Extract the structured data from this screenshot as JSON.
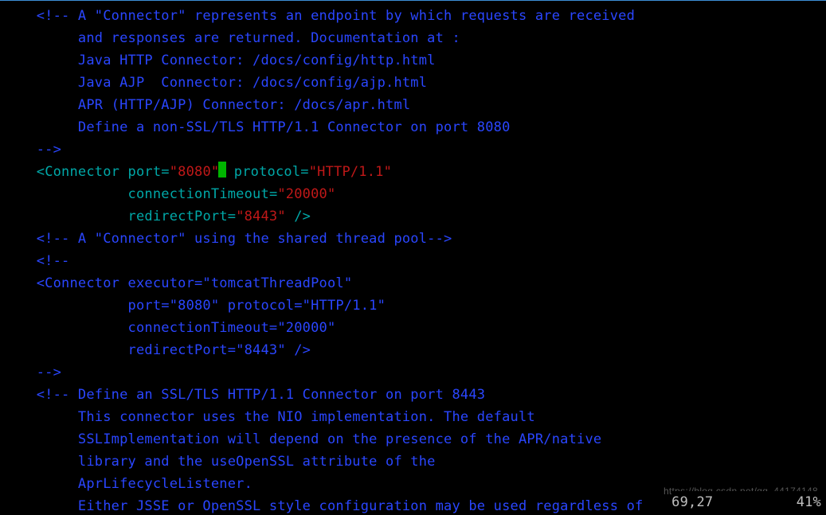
{
  "code": {
    "c1": "    <!-- A \"Connector\" represents an endpoint by which requests are received",
    "c2": "         and responses are returned. Documentation at :",
    "c3": "         Java HTTP Connector: /docs/config/http.html",
    "c4": "         Java AJP  Connector: /docs/config/ajp.html",
    "c5": "         APR (HTTP/AJP) Connector: /docs/apr.html",
    "c6": "         Define a non-SSL/TLS HTTP/1.1 Connector on port 8080",
    "c7": "    -->",
    "conn1": {
      "open": "    <",
      "tag": "Connector ",
      "a1": "port",
      "eq": "=",
      "v1": "\"8080\"",
      "a2": " protocol",
      "v2": "\"HTTP/1.1\"",
      "l2pad": "               ",
      "a3": "connectionTimeout",
      "v3": "\"20000\"",
      "l3pad": "               ",
      "a4": "redirectPort",
      "v4": "\"8443\"",
      "close": " />"
    },
    "c8": "    <!-- A \"Connector\" using the shared thread pool-->",
    "c9": "    <!--",
    "c10": "    <Connector executor=\"tomcatThreadPool\"",
    "c11": "               port=\"8080\" protocol=\"HTTP/1.1\"",
    "c12": "               connectionTimeout=\"20000\"",
    "c13": "               redirectPort=\"8443\" />",
    "c14": "    -->",
    "c15": "    <!-- Define an SSL/TLS HTTP/1.1 Connector on port 8443",
    "c16": "         This connector uses the NIO implementation. The default",
    "c17": "         SSLImplementation will depend on the presence of the APR/native",
    "c18": "         library and the useOpenSSL attribute of the",
    "c19": "         AprLifecycleListener.",
    "c20": "         Either JSSE or OpenSSL style configuration may be used regardless of"
  },
  "status": {
    "pos": "69,27",
    "gap": "          ",
    "pct": "41%"
  },
  "watermark": "https://blog.csdn.net/qq_44174148"
}
